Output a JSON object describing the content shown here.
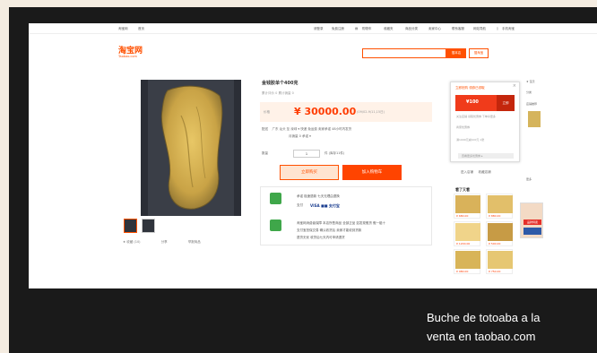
{
  "caption": {
    "line1": "Buche de totoaba a la",
    "line2": "venta en taobao.com"
  },
  "topbar": {
    "left1": "淘宝网",
    "left2": "首页",
    "login": "请登录",
    "register": "免费注册",
    "cart": "购物车",
    "fav": "收藏夹",
    "sellers": "商品分类",
    "seller_center": "卖家中心",
    "contact": "联系客服",
    "nav": "网站导航",
    "mobile": "手机淘宝"
  },
  "header": {
    "logo": "淘宝网",
    "logo_sub": "Taobao.com",
    "search_button": "搜本店",
    "search_button2": "搜淘宝",
    "search_value": ""
  },
  "product": {
    "title": "金钱胶单个400克",
    "subline": "累计评价 0    累计销量 0",
    "price_label": "价格",
    "price": "¥ 30000.00",
    "price_note": "(09/02-9/11,15日)",
    "ship_label": "配送",
    "ship_value": "广东 汕头 至 深圳 ▾  快递 免运费  卖家承诺 48小时内发货",
    "ship_value2": "月销量 0   承诺 ▾",
    "qty_label": "数量",
    "qty_value": "1",
    "qty_note": "件 (库存11件)",
    "buy_button": "立即购买",
    "cart_button": "加入购物车",
    "guarantee1": "承诺  极速退款  七天无理由退换",
    "guarantee_pay": "支付",
    "pay_logos": "VISA  ■■  支付宝",
    "guarantee2": "淘宝网消费者保障   本店所售商品  全部正品  如发现假货  假一赔十",
    "guarantee3": "支付宝担保交易   确认收货后  卖家才能收到货款",
    "guarantee4": "退货无忧  收货后七天内可申请退货"
  },
  "share": {
    "fav": "★ 收藏 (10)",
    "share": "分享",
    "report": "举报商品"
  },
  "popup": {
    "close": "×",
    "tabs": "立即抢购  领券已领取",
    "amount": "¥100",
    "btn": "立即",
    "line1": "关注店铺  领取优惠券  下单享更多",
    "line2": "商家优惠券",
    "line3": "满1000元减100元    1张",
    "line4": "查看更多优惠券 ▸"
  },
  "aside": {
    "mini1": "进入店铺",
    "mini2": "收藏店铺",
    "rec_title": "看了又看",
    "prices": [
      "¥ 680.00",
      "¥ 880.00",
      "¥ 1200.00",
      "¥ 500.00",
      "¥ 980.00",
      "¥ 750.00"
    ]
  },
  "right_col": {
    "line1": "★ 宝贝",
    "line2": "分类",
    "line3": "店铺推荐",
    "more": "更多",
    "ad_text": "品牌特卖"
  },
  "colors": {
    "accent": "#ff5000",
    "price": "#ff3c00",
    "buy_bg": "#ffe4d0",
    "cart_bg": "#ff4400"
  }
}
